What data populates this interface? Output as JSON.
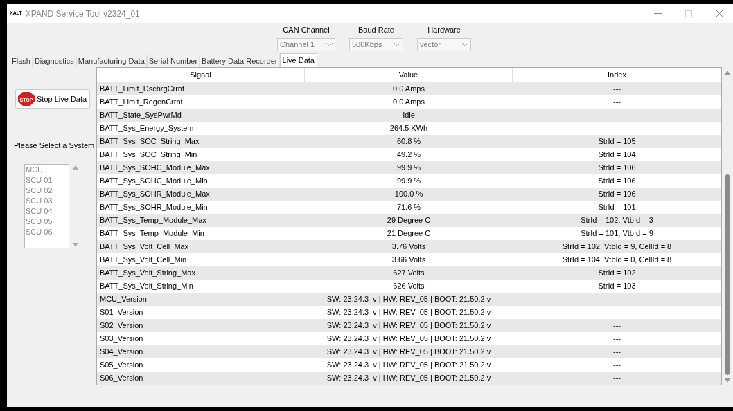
{
  "window": {
    "logo_text": "XALT",
    "title": "XPAND Service Tool v2324_01"
  },
  "connection": [
    {
      "label": "CAN Channel",
      "value": "Channel 1"
    },
    {
      "label": "Baud Rate",
      "value": "500Kbps"
    },
    {
      "label": "Hardware",
      "value": "vector"
    }
  ],
  "tabs": [
    {
      "label": "Flash",
      "selected": false
    },
    {
      "label": "Diagnostics",
      "selected": false
    },
    {
      "label": "Manufacturing Data",
      "selected": false
    },
    {
      "label": "Serial Number",
      "selected": false
    },
    {
      "label": "Battery Data Recorder",
      "selected": false
    },
    {
      "label": "Live Data",
      "selected": true
    }
  ],
  "stop_button": {
    "icon_text": "STOP",
    "label": "Stop Live Data"
  },
  "system_select": {
    "label": "Please Select a System",
    "disabled": true,
    "items": [
      "MCU",
      "SCU 01",
      "SCU 02",
      "SCU 03",
      "SCU 04",
      "SCU 05",
      "SCU 06"
    ]
  },
  "table": {
    "columns": [
      "Signal",
      "Value",
      "Index"
    ],
    "rows": [
      [
        "BATT_Limit_DschrgCrrnt",
        "0.0 Amps",
        "---"
      ],
      [
        "BATT_Limit_RegenCrrnt",
        "0.0 Amps",
        "---"
      ],
      [
        "BATT_State_SysPwrMd",
        "Idle",
        "---"
      ],
      [
        "BATT_Sys_Energy_System",
        "264.5 KWh",
        "---"
      ],
      [
        "BATT_Sys_SOC_String_Max",
        "60.8 %",
        "StrId = 105"
      ],
      [
        "BATT_Sys_SOC_String_Min",
        "49.2 %",
        "StrId = 104"
      ],
      [
        "BATT_Sys_SOHC_Module_Max",
        "99.9 %",
        "StrId = 106"
      ],
      [
        "BATT_Sys_SOHC_Module_Min",
        "99.9 %",
        "StrId = 106"
      ],
      [
        "BATT_Sys_SOHR_Module_Max",
        "100.0 %",
        "StrId = 106"
      ],
      [
        "BATT_Sys_SOHR_Module_Min",
        "71.6 %",
        "StrId = 101"
      ],
      [
        "BATT_Sys_Temp_Module_Max",
        "29 Degree C",
        "StrId = 102, VtbId = 3"
      ],
      [
        "BATT_Sys_Temp_Module_Min",
        "21 Degree C",
        "StrId = 101, VtbId = 9"
      ],
      [
        "BATT_Sys_Volt_Cell_Max",
        "3.76 Volts",
        "StrId = 102, VtbId = 9, CellId = 8"
      ],
      [
        "BATT_Sys_Volt_Cell_Min",
        "3.66 Volts",
        "StrId = 104, VtbId = 0, CellId = 8"
      ],
      [
        "BATT_Sys_Volt_String_Max",
        "627 Volts",
        "StrId = 102"
      ],
      [
        "BATT_Sys_Volt_String_Min",
        "626 Volts",
        "StrId = 103"
      ],
      [
        "MCU_Version",
        "SW: 23.24.3  v | HW: REV_05 | BOOT: 21.50.2 v",
        "---"
      ],
      [
        "S01_Version",
        "SW: 23.24.3  v | HW: REV_05 | BOOT: 21.50.2 v",
        "---"
      ],
      [
        "S02_Version",
        "SW: 23.24.3  v | HW: REV_05 | BOOT: 21.50.2 v",
        "---"
      ],
      [
        "S03_Version",
        "SW: 23.24.3  v | HW: REV_05 | BOOT: 21.50.2 v",
        "---"
      ],
      [
        "S04_Version",
        "SW: 23.24.3  v | HW: REV_05 | BOOT: 21.50.2 v",
        "---"
      ],
      [
        "S05_Version",
        "SW: 23.24.3  v | HW: REV_05 | BOOT: 21.50.2 v",
        "---"
      ],
      [
        "S06_Version",
        "SW: 23.24.3  v | HW: REV_05 | BOOT: 21.50.2 v",
        "---"
      ]
    ]
  }
}
